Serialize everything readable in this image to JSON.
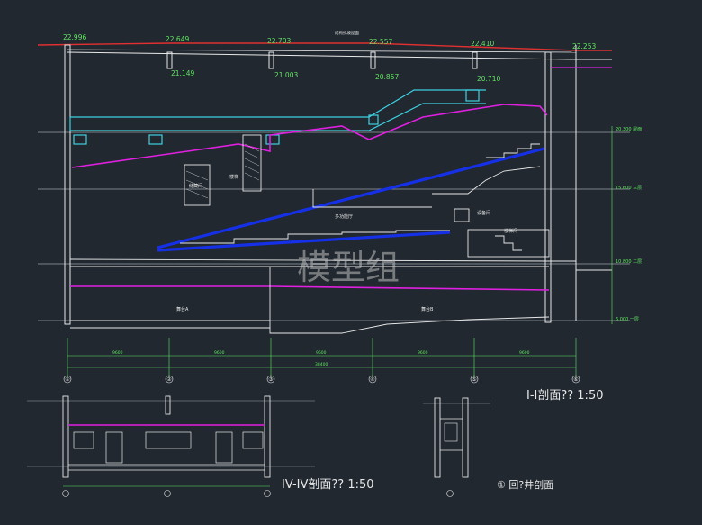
{
  "colors": {
    "background": "#212830",
    "grid": "#d8d8d8",
    "structure": "#e8e8e8",
    "elevation": "#5fe65f",
    "duct": "#3fd0e0",
    "ceiling": "#e020e0",
    "seating": "#1530e6",
    "roof": "#e03030",
    "note": "#e0e040"
  },
  "main_section": {
    "top_elevations": [
      "22.996",
      "22.649",
      "22.703",
      "22.557",
      "22.410",
      "22.253"
    ],
    "sub_elevations": [
      "21.149",
      "21.003",
      "20.857",
      "20.710"
    ],
    "roof_note": "结构找坡屋面",
    "room_labels": [
      "多功能厅",
      "舞台A",
      "舞台B",
      "设备间",
      "楼梯间",
      "楼梯",
      "储藏间"
    ],
    "level_marks": [
      "20.300 屋面",
      "15.600 三层",
      "10.800 二层",
      "6.000 一层"
    ],
    "watermark": "模型组",
    "dimensions": [
      "9600",
      "9600",
      "9600",
      "9600",
      "9600",
      "38400"
    ]
  },
  "sections": {
    "section_1": {
      "title": "I-I剖面?? 1:50"
    },
    "section_4": {
      "title": "IV-IV剖面?? 1:50"
    },
    "section_detail": {
      "title": "① 回?井剖面"
    }
  },
  "axis_labels": [
    "①",
    "②",
    "③",
    "④",
    "⑤",
    "⑥"
  ]
}
